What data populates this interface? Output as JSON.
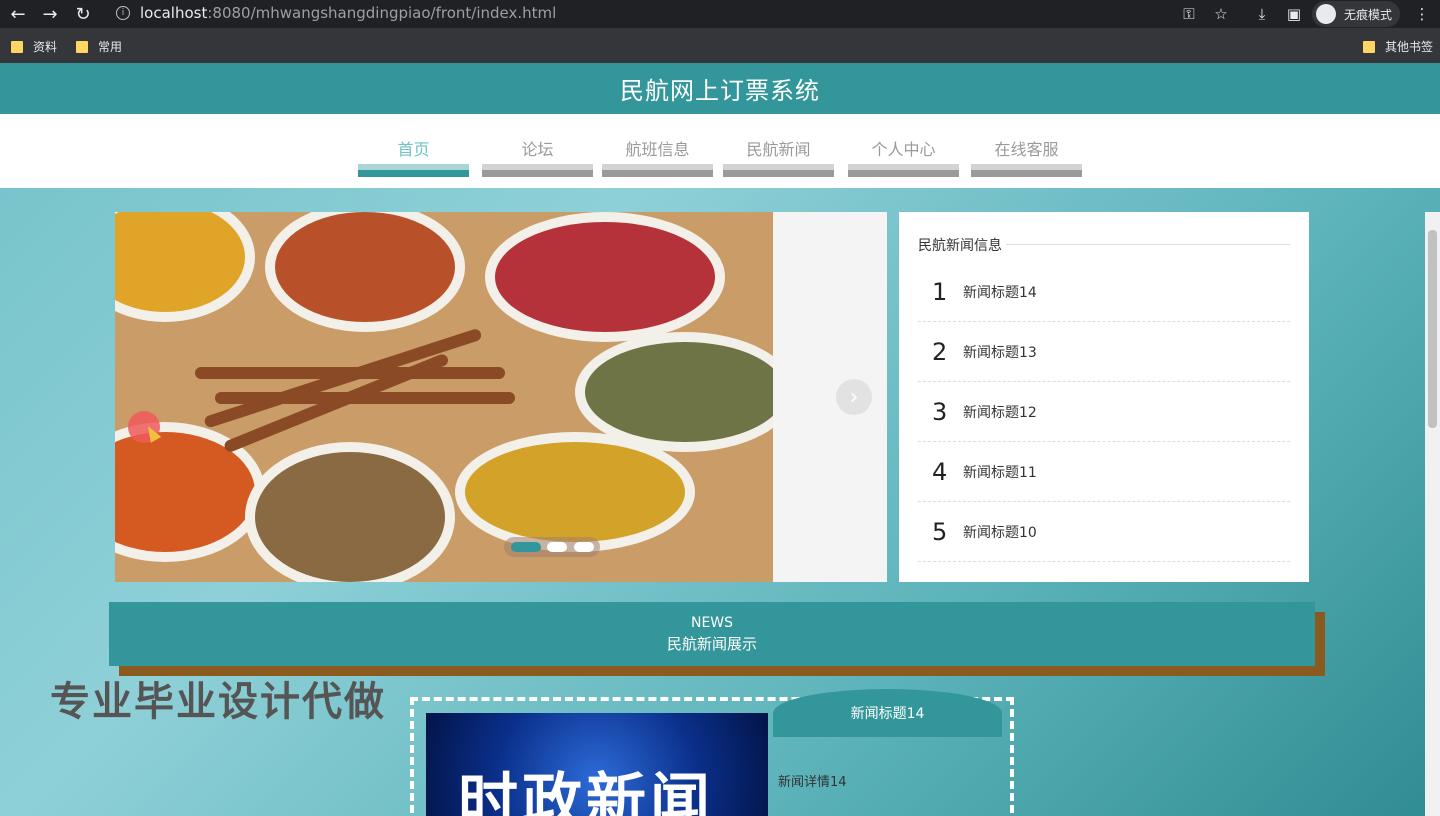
{
  "browser": {
    "url_host": "localhost",
    "url_rest": ":8080/mhwangshangdingpiao/front/index.html",
    "incognito_label": "无痕模式",
    "bookmarks": [
      "资料",
      "常用"
    ],
    "other_bookmarks": "其他书签"
  },
  "site": {
    "title": "民航网上订票系统",
    "nav": [
      {
        "label": "首页",
        "active": true
      },
      {
        "label": "论坛"
      },
      {
        "label": "航班信息"
      },
      {
        "label": "民航新闻"
      },
      {
        "label": "个人中心"
      },
      {
        "label": "在线客服"
      }
    ]
  },
  "carousel": {
    "slides": 3,
    "active_slide": 1,
    "next_icon": "chevron-right-icon"
  },
  "news_panel": {
    "title": "民航新闻信息",
    "items": [
      {
        "num": "1",
        "title": "新闻标题14"
      },
      {
        "num": "2",
        "title": "新闻标题13"
      },
      {
        "num": "3",
        "title": "新闻标题12"
      },
      {
        "num": "4",
        "title": "新闻标题11"
      },
      {
        "num": "5",
        "title": "新闻标题10"
      }
    ]
  },
  "section": {
    "en": "NEWS",
    "cn": "民航新闻展示"
  },
  "watermark": "专业毕业设计代做",
  "news_card": {
    "image_text": "时政新闻",
    "title": "新闻标题14",
    "detail": "新闻详情14"
  },
  "colors": {
    "primary": "#33969a",
    "accent_shadow": "#8a5a1f"
  }
}
